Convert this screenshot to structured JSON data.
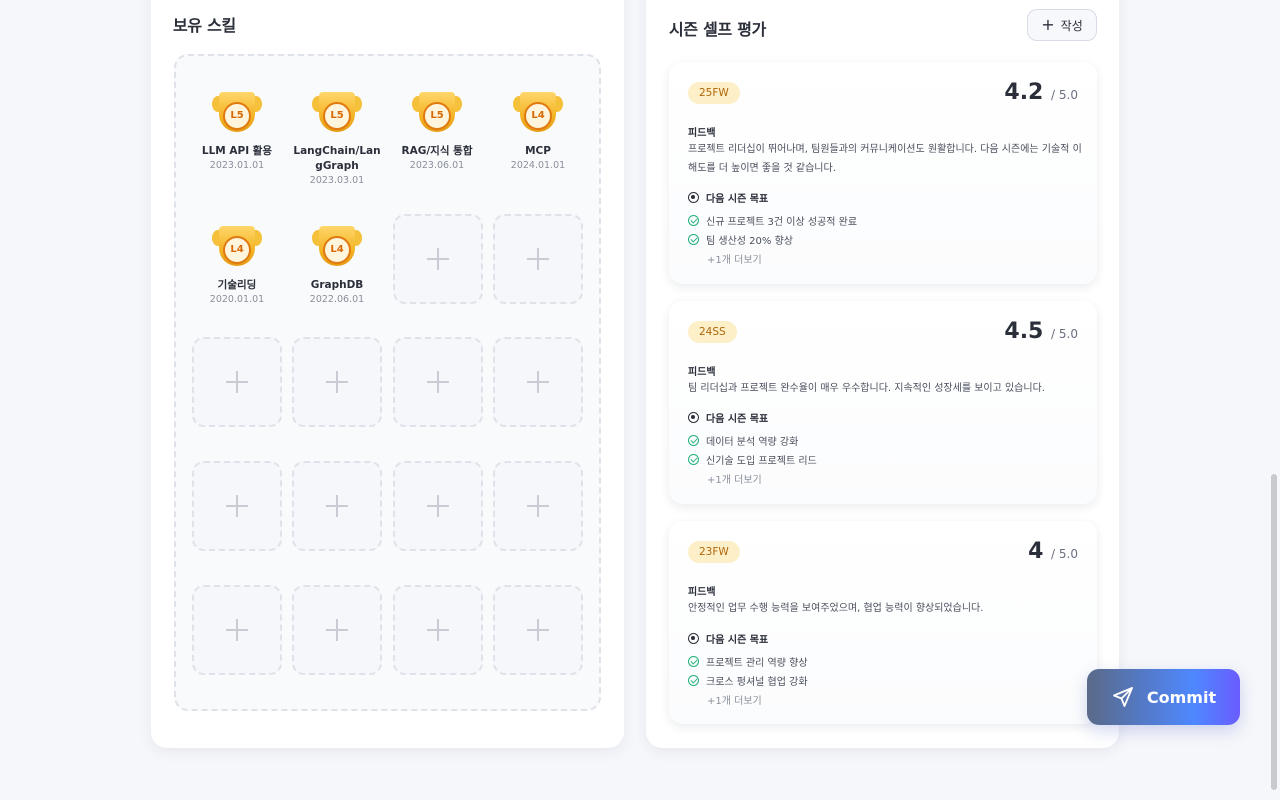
{
  "skills": {
    "title": "보유 스킬",
    "items": [
      {
        "level": "L5",
        "name": "LLM API 활용",
        "date": "2023.01.01"
      },
      {
        "level": "L5",
        "name": "LangChain/LangGraph",
        "date": "2023.03.01"
      },
      {
        "level": "L5",
        "name": "RAG/지식 통합",
        "date": "2023.06.01"
      },
      {
        "level": "L4",
        "name": "MCP",
        "date": "2024.01.01"
      },
      {
        "level": "L4",
        "name": "기술리딩",
        "date": "2020.01.01"
      },
      {
        "level": "L4",
        "name": "GraphDB",
        "date": "2022.06.01"
      }
    ],
    "empty_slot_count": 14
  },
  "evaluation": {
    "title": "시즌 셀프 평가",
    "write_label": "작성",
    "feedback_label": "피드백",
    "goal_label": "다음 시즌 목표",
    "items": [
      {
        "season": "25FW",
        "score": "4.2",
        "max": "/ 5.0",
        "feedback": "프로젝트 리더십이 뛰어나며, 팀원들과의 커뮤니케이션도 원활합니다. 다음 시즌에는 기술적 이해도를 더 높이면 좋을 것 같습니다.",
        "goals": [
          "신규 프로젝트 3건 이상 성공적 완료",
          "팀 생산성 20% 향상"
        ],
        "more": "+1개 더보기"
      },
      {
        "season": "24SS",
        "score": "4.5",
        "max": "/ 5.0",
        "feedback": "팀 리더십과 프로젝트 완수율이 매우 우수합니다. 지속적인 성장세를 보이고 있습니다.",
        "goals": [
          "데이터 분석 역량 강화",
          "신기술 도입 프로젝트 리드"
        ],
        "more": "+1개 더보기"
      },
      {
        "season": "23FW",
        "score": "4",
        "max": "/ 5.0",
        "feedback": "안정적인 업무 수행 능력을 보여주었으며, 협업 능력이 향상되었습니다.",
        "goals": [
          "프로젝트 관리 역량 향상",
          "크로스 펑셔널 협업 강화"
        ],
        "more": "+1개 더보기"
      }
    ]
  },
  "commit": {
    "label": "Commit",
    "icon": "send-icon"
  },
  "colors": {
    "accent_gradient_start": "#5a6a88",
    "accent_gradient_end": "#6a5cff",
    "badge_bg": "#fdf0c8",
    "badge_text": "#b0650a",
    "trophy_gold": "#f4b425",
    "check_green": "#22b07a"
  }
}
